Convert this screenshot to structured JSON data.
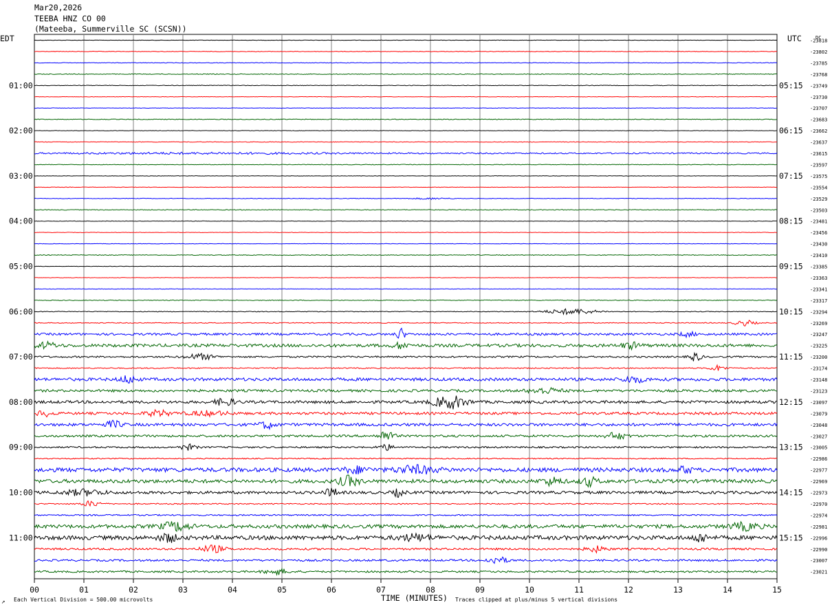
{
  "header": {
    "date": "Mar20,2026",
    "station": "TEEBA HNZ CO 00",
    "location": "(Mateeba, Summerville SC (SCSN))"
  },
  "left_axis_title": "EDT",
  "right_axis_title": "UTC",
  "dc_label": "DC",
  "footer": {
    "scale_note": "Each Vertical Division =  500.00 microvolts",
    "x_axis_title": "TIME (MINUTES)",
    "clip_note": "Traces clipped at plus/minus 5 vertical divisions",
    "corner_mark": "↗"
  },
  "colors": {
    "trace_cycle": [
      "#000000",
      "#ff0000",
      "#0000ff",
      "#006400"
    ],
    "gridline": "#808080",
    "frame": "#000000"
  },
  "chart_data": {
    "type": "line",
    "subtype": "helicorder",
    "traces_per_row_cycle": 4,
    "minutes_per_trace": 15,
    "x_range": [
      0,
      15
    ],
    "x_ticks": [
      "00",
      "01",
      "02",
      "03",
      "04",
      "05",
      "06",
      "07",
      "08",
      "09",
      "10",
      "11",
      "12",
      "13",
      "14",
      "15"
    ],
    "edt_hour_labels": [
      {
        "row": 0,
        "label": ""
      },
      {
        "row": 4,
        "label": "01:00"
      },
      {
        "row": 8,
        "label": "02:00"
      },
      {
        "row": 12,
        "label": "03:00"
      },
      {
        "row": 16,
        "label": "04:00"
      },
      {
        "row": 20,
        "label": "05:00"
      },
      {
        "row": 24,
        "label": "06:00"
      },
      {
        "row": 28,
        "label": "07:00"
      },
      {
        "row": 32,
        "label": "08:00"
      },
      {
        "row": 36,
        "label": "09:00"
      },
      {
        "row": 40,
        "label": "10:00"
      },
      {
        "row": 44,
        "label": "11:00"
      }
    ],
    "utc_hour_labels": [
      {
        "row": 4,
        "label": "05:15"
      },
      {
        "row": 8,
        "label": "06:15"
      },
      {
        "row": 12,
        "label": "07:15"
      },
      {
        "row": 16,
        "label": "08:15"
      },
      {
        "row": 20,
        "label": "09:15"
      },
      {
        "row": 24,
        "label": "10:15"
      },
      {
        "row": 28,
        "label": "11:15"
      },
      {
        "row": 32,
        "label": "12:15"
      },
      {
        "row": 36,
        "label": "13:15"
      },
      {
        "row": 40,
        "label": "14:15"
      },
      {
        "row": 44,
        "label": "15:15"
      }
    ],
    "dc_offsets": [
      "-23818",
      "-23802",
      "-23785",
      "-23768",
      "-23749",
      "-23730",
      "-23707",
      "-23683",
      "-23662",
      "-23637",
      "-23615",
      "-23597",
      "-23575",
      "-23554",
      "-23529",
      "-23503",
      "-23481",
      "-23456",
      "-23430",
      "-23410",
      "-23385",
      "-23363",
      "-23341",
      "-23317",
      "-23294",
      "-23269",
      "-23247",
      "-23225",
      "-23200",
      "-23174",
      "-23148",
      "-23123",
      "-23097",
      "-23079",
      "-23048",
      "-23027",
      "-23005",
      "-22986",
      "-22977",
      "-22969",
      "-22973",
      "-22970",
      "-22974",
      "-22981",
      "-22996",
      "-22990",
      "-23007",
      "-23021"
    ],
    "trace_noise": [
      0.3,
      0.4,
      0.4,
      0.5,
      0.4,
      0.3,
      0.3,
      0.5,
      0.3,
      0.4,
      0.9,
      0.4,
      0.3,
      0.3,
      0.4,
      0.5,
      0.3,
      0.3,
      0.3,
      0.5,
      0.3,
      0.3,
      0.3,
      0.5,
      0.5,
      0.6,
      1.6,
      2.2,
      1.2,
      0.8,
      2.2,
      1.8,
      2.0,
      1.8,
      2.0,
      1.6,
      1.2,
      0.8,
      3.0,
      2.6,
      2.0,
      0.8,
      1.0,
      2.6,
      3.0,
      1.5,
      1.4,
      1.3
    ],
    "bursts": [
      {
        "row": 10,
        "minute": 0.0,
        "duration": 7.0,
        "amplitude": 0.8
      },
      {
        "row": 14,
        "minute": 7.5,
        "duration": 1.0,
        "amplitude": 1.0
      },
      {
        "row": 24,
        "minute": 10.2,
        "duration": 1.3,
        "amplitude": 4.0
      },
      {
        "row": 25,
        "minute": 14.1,
        "duration": 0.5,
        "amplitude": 4.0
      },
      {
        "row": 26,
        "minute": 7.3,
        "duration": 0.2,
        "amplitude": 9.0
      },
      {
        "row": 26,
        "minute": 13.0,
        "duration": 0.4,
        "amplitude": 3.0
      },
      {
        "row": 27,
        "minute": 0.0,
        "duration": 0.5,
        "amplitude": 4.0
      },
      {
        "row": 27,
        "minute": 7.2,
        "duration": 0.4,
        "amplitude": 4.0
      },
      {
        "row": 27,
        "minute": 11.8,
        "duration": 0.5,
        "amplitude": 4.0
      },
      {
        "row": 28,
        "minute": 3.0,
        "duration": 0.7,
        "amplitude": 4.0
      },
      {
        "row": 28,
        "minute": 13.2,
        "duration": 0.3,
        "amplitude": 6.0
      },
      {
        "row": 29,
        "minute": 13.6,
        "duration": 0.4,
        "amplitude": 4.0
      },
      {
        "row": 30,
        "minute": 1.7,
        "duration": 0.4,
        "amplitude": 5.0
      },
      {
        "row": 30,
        "minute": 11.8,
        "duration": 0.6,
        "amplitude": 4.0
      },
      {
        "row": 31,
        "minute": 9.9,
        "duration": 0.8,
        "amplitude": 4.0
      },
      {
        "row": 32,
        "minute": 3.6,
        "duration": 0.5,
        "amplitude": 5.0
      },
      {
        "row": 32,
        "minute": 8.0,
        "duration": 0.8,
        "amplitude": 9.0
      },
      {
        "row": 33,
        "minute": 0.0,
        "duration": 0.4,
        "amplitude": 4.0
      },
      {
        "row": 33,
        "minute": 2.2,
        "duration": 0.6,
        "amplitude": 4.0
      },
      {
        "row": 33,
        "minute": 3.0,
        "duration": 1.0,
        "amplitude": 3.0
      },
      {
        "row": 34,
        "minute": 1.4,
        "duration": 0.4,
        "amplitude": 5.0
      },
      {
        "row": 34,
        "minute": 4.5,
        "duration": 0.4,
        "amplitude": 5.0
      },
      {
        "row": 35,
        "minute": 6.9,
        "duration": 0.4,
        "amplitude": 7.0
      },
      {
        "row": 35,
        "minute": 11.5,
        "duration": 0.5,
        "amplitude": 5.0
      },
      {
        "row": 36,
        "minute": 2.9,
        "duration": 0.4,
        "amplitude": 4.0
      },
      {
        "row": 36,
        "minute": 6.9,
        "duration": 0.4,
        "amplitude": 4.0
      },
      {
        "row": 38,
        "minute": 6.2,
        "duration": 0.6,
        "amplitude": 4.0
      },
      {
        "row": 38,
        "minute": 7.2,
        "duration": 1.0,
        "amplitude": 5.0
      },
      {
        "row": 38,
        "minute": 13.0,
        "duration": 0.3,
        "amplitude": 5.0
      },
      {
        "row": 39,
        "minute": 6.1,
        "duration": 0.5,
        "amplitude": 7.0
      },
      {
        "row": 39,
        "minute": 10.2,
        "duration": 0.5,
        "amplitude": 5.0
      },
      {
        "row": 39,
        "minute": 11.0,
        "duration": 0.4,
        "amplitude": 6.0
      },
      {
        "row": 40,
        "minute": 0.5,
        "duration": 1.0,
        "amplitude": 4.0
      },
      {
        "row": 40,
        "minute": 5.8,
        "duration": 0.4,
        "amplitude": 5.0
      },
      {
        "row": 40,
        "minute": 7.2,
        "duration": 0.3,
        "amplitude": 5.0
      },
      {
        "row": 41,
        "minute": 0.9,
        "duration": 0.5,
        "amplitude": 4.0
      },
      {
        "row": 43,
        "minute": 2.5,
        "duration": 0.7,
        "amplitude": 6.0
      },
      {
        "row": 43,
        "minute": 14.0,
        "duration": 0.7,
        "amplitude": 5.0
      },
      {
        "row": 44,
        "minute": 2.5,
        "duration": 0.4,
        "amplitude": 6.0
      },
      {
        "row": 44,
        "minute": 7.3,
        "duration": 0.8,
        "amplitude": 4.0
      },
      {
        "row": 44,
        "minute": 13.3,
        "duration": 0.3,
        "amplitude": 7.0
      },
      {
        "row": 45,
        "minute": 3.3,
        "duration": 0.6,
        "amplitude": 5.0
      },
      {
        "row": 45,
        "minute": 11.1,
        "duration": 0.5,
        "amplitude": 4.0
      },
      {
        "row": 46,
        "minute": 9.1,
        "duration": 0.5,
        "amplitude": 5.0
      },
      {
        "row": 47,
        "minute": 4.6,
        "duration": 0.6,
        "amplitude": 4.0
      }
    ]
  }
}
